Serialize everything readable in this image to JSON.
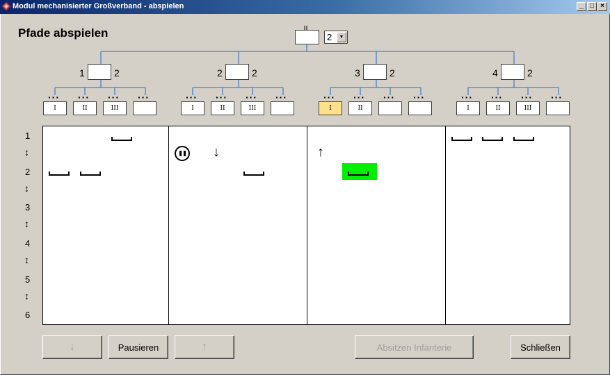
{
  "window": {
    "title": "Modul mechanisierter Großverband - abspielen"
  },
  "heading": "Pfade abspielen",
  "top_selector": {
    "value": "2"
  },
  "groups": [
    {
      "left_label": "1",
      "right_label": "2",
      "units": [
        "I",
        "II",
        "III",
        ""
      ],
      "active_unit": -1
    },
    {
      "left_label": "2",
      "right_label": "2",
      "units": [
        "I",
        "II",
        "III",
        ""
      ],
      "active_unit": -1
    },
    {
      "left_label": "3",
      "right_label": "2",
      "units": [
        "I",
        "II",
        "",
        ""
      ],
      "active_unit": 0
    },
    {
      "left_label": "4",
      "right_label": "2",
      "units": [
        "I",
        "II",
        "III",
        ""
      ],
      "active_unit": -1
    }
  ],
  "rows": [
    "1",
    "2",
    "3",
    "4",
    "5",
    "6"
  ],
  "row_separator_glyph": "↕",
  "colors": {
    "highlight": "#00ee00",
    "active_unit": "#ffe08a",
    "tree_line": "#4a7fc1"
  },
  "icons": {
    "pause": "pause-circle-icon",
    "down": "down-arrow-icon",
    "up": "up-arrow-icon"
  },
  "glyphs": {
    "down": "↓",
    "up": "↑"
  },
  "buttons": {
    "down": "↓",
    "pause": "Pausieren",
    "up": "↑",
    "dismount": "Absitzen Infanterie",
    "close": "Schließen"
  }
}
